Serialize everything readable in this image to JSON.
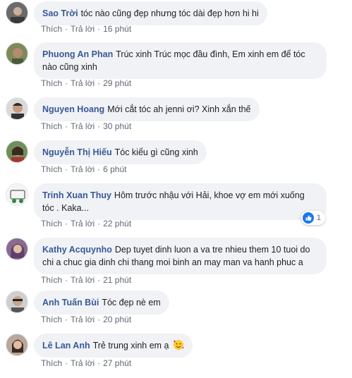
{
  "comments": [
    {
      "author": "Sao Trời",
      "text": "tóc nào cũng đẹp nhưng tóc dài đẹp hơn hi hi",
      "like": "Thích",
      "reply": "Trả lời",
      "time": "16 phút"
    },
    {
      "author": "Phuong An Phan",
      "text": "Trúc xinh Trúc mọc đầu đình, Em xinh em để tóc nào cũng xinh",
      "like": "Thích",
      "reply": "Trả lời",
      "time": "29 phút"
    },
    {
      "author": "Nguyen Hoang",
      "text": "Mới cắt tóc ah jenni ơi? Xinh xắn thế",
      "like": "Thích",
      "reply": "Trả lời",
      "time": "30 phút"
    },
    {
      "author": "Nguyễn Thị Hiếu",
      "text": "Tóc kiểu gì cũng xinh",
      "like": "Thích",
      "reply": "Trả lời",
      "time": "6 phút"
    },
    {
      "author": "Trinh Xuan Thuy",
      "text": "Hôm trước nhậu với Hải, khoe vợ em mới xuống tóc . Kaka...",
      "like": "Thích",
      "reply": "Trả lời",
      "time": "22 phút",
      "reaction_count": "1"
    },
    {
      "author": "Kathy Acquynho",
      "text": "Dep tuyet dinh luon a va tre nhieu them 10 tuoi do chi a chuc gia dinh chi thang moi binh an may man va hanh phuc a",
      "like": "Thích",
      "reply": "Trả lời",
      "time": "21 phút"
    },
    {
      "author": "Anh Tuấn Bùi",
      "text": "Tóc đẹp nè em",
      "like": "Thích",
      "reply": "Trả lời",
      "time": "20 phút"
    },
    {
      "author": "Lê Lan Anh",
      "text": "Trẻ trung xinh em ạ",
      "like": "Thích",
      "reply": "Trả lời",
      "time": "27 phút",
      "emoji": "smiling-face-with-hearts-icon"
    }
  ],
  "colors": {
    "author": "#385898",
    "bubble": "#f0f2f5",
    "meta": "#606770",
    "like_blue": "#1877f2"
  }
}
